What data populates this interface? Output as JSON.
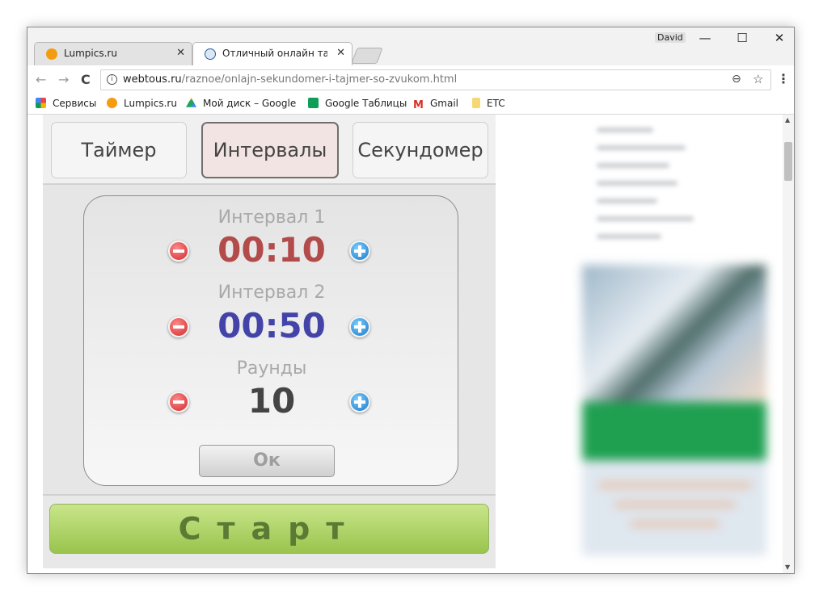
{
  "browser": {
    "user": "David",
    "window_controls": {
      "minimize": "—",
      "maximize": "☐",
      "close": "✕"
    },
    "tabs": [
      {
        "title": "Lumpics.ru",
        "close": "✕",
        "favicon": "orange-circle-icon"
      },
      {
        "title": "Отличный онлайн тайме",
        "close": "✕",
        "favicon": "globe-icon"
      }
    ],
    "nav": {
      "back": "←",
      "forward": "→",
      "reload": "C"
    },
    "url": {
      "domain": "webtous.ru",
      "path": "/raznoe/onlajn-sekundomer-i-tajmer-so-zvukom.html"
    },
    "toolbar_icons": {
      "zoom": "⊖",
      "star": "☆",
      "menu": "⋮"
    },
    "bookmarks": [
      {
        "label": "Сервисы",
        "icon": "apps-grid-icon",
        "color": "#e44"
      },
      {
        "label": "Lumpics.ru",
        "icon": "orange-circle-icon",
        "color": "#f39c12"
      },
      {
        "label": "Мой диск – Google ",
        "icon": "google-drive-icon",
        "color": "#1fa463"
      },
      {
        "label": "Google Таблицы",
        "icon": "google-sheets-icon",
        "color": "#0f9d58"
      },
      {
        "label": "Gmail",
        "icon": "gmail-icon",
        "color": "#d93025"
      },
      {
        "label": "ETC",
        "icon": "folder-icon",
        "color": "#f7d774"
      }
    ]
  },
  "timer_app": {
    "modes": [
      "Таймер",
      "Интервалы",
      "Секундомер"
    ],
    "active_mode": "Интервалы",
    "rows": [
      {
        "label": "Интервал 1",
        "value": "00:10",
        "color": "#b34b4b"
      },
      {
        "label": "Интервал 2",
        "value": "00:50",
        "color": "#4444a8"
      },
      {
        "label": "Раунды",
        "value": "10",
        "color": "#444444"
      }
    ],
    "ok_label": "Ок",
    "start_label": "Старт",
    "colors": {
      "start_green": "#a8cf5c",
      "active_mode_bg": "#f1e4e2"
    }
  }
}
